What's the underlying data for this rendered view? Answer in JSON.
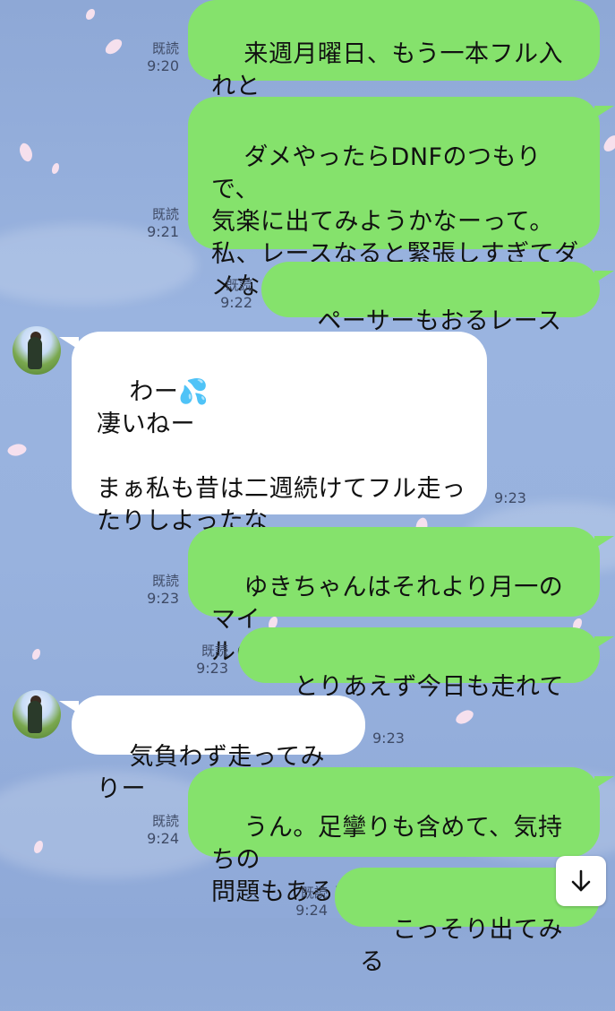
{
  "read_label": "既読",
  "messages": [
    {
      "text": "来週月曜日、もう一本フル入れと\nるんよね。河川敷やけど、公認。",
      "time": "9:20"
    },
    {
      "text": "ダメやったらDNFのつもりで、\n気楽に出てみようかなーって。\n私、レースなると緊張しすぎてダ\nメなのかもなって。",
      "time": "9:21"
    },
    {
      "text": "ペーサーもおるレースやし",
      "time": "9:22"
    },
    {
      "text": "わー💦\n凄いねー\n\nまぁ私も昔は二週続けてフル走っ\nたりしよったな",
      "time": "9:23"
    },
    {
      "text": "ゆきちゃんはそれより月一のマイ\nルのがヤバいやん😂",
      "time": "9:23"
    },
    {
      "text": "とりあえず今日も走れてるし",
      "time": "9:23"
    },
    {
      "text": "気負わず走ってみりー",
      "time": "9:23"
    },
    {
      "text": "うん。足攣りも含めて、気持ちの\n問題もあるかもしれんから",
      "time": "9:24"
    },
    {
      "text": "こっそり出てみる",
      "time": "9:24"
    }
  ],
  "colors": {
    "outgoing_bubble": "#85e26c",
    "incoming_bubble": "#ffffff",
    "background": "#98b2de",
    "petal": "#fbe3ee"
  },
  "icons": {
    "scroll_down": "arrow-down-icon",
    "avatar": "avatar"
  }
}
